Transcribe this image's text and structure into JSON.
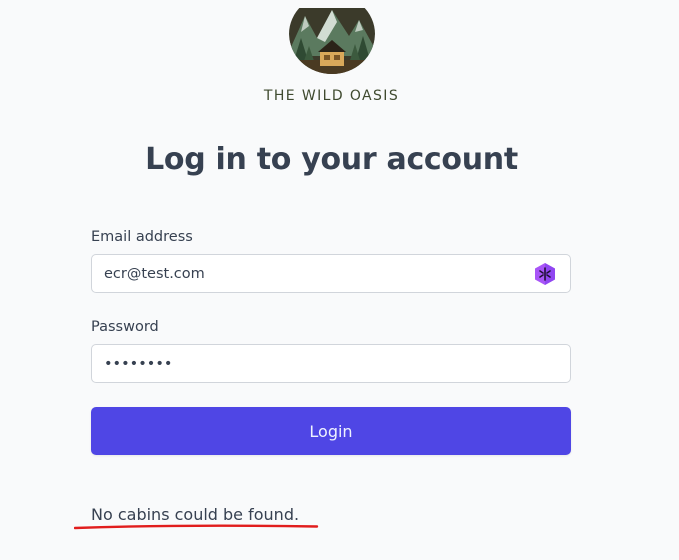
{
  "brand": {
    "name": "THE WILD OASIS"
  },
  "heading": "Log in to your account",
  "form": {
    "email_label": "Email address",
    "email_value": "ecr@test.com",
    "password_label": "Password",
    "password_value": "••••••••",
    "login_label": "Login"
  },
  "status_message": "No cabins could be found.",
  "colors": {
    "primary": "#4f46e5",
    "annotation": "#e11d1d",
    "background": "#f9fafb"
  },
  "icons": [
    "logo-mountain-cabin",
    "password-manager-icon"
  ]
}
